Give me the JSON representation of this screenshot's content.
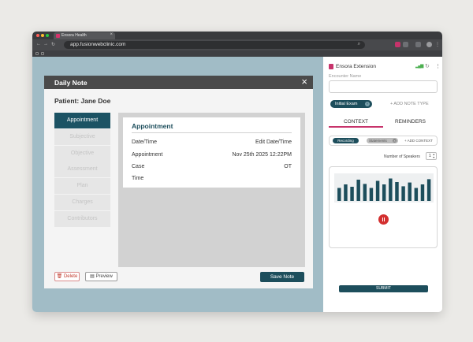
{
  "browser": {
    "tab_title": "Ensora Health",
    "tab_close": "×",
    "url": "app.fusionwebclinic.com"
  },
  "dialog": {
    "title": "Daily Note",
    "close": "×",
    "patient": "Patient: Jane Doe",
    "nav": [
      {
        "label": "Appointment",
        "active": true
      },
      {
        "label": "Subjective"
      },
      {
        "label": "Objective"
      },
      {
        "label": "Assessment"
      },
      {
        "label": "Plan"
      },
      {
        "label": "Charges"
      },
      {
        "label": "Contributors"
      }
    ],
    "card": {
      "title": "Appointment",
      "rows": [
        {
          "label": "Date/Time",
          "value": "Edit Date/Time"
        },
        {
          "label": "Appointment",
          "value": "Nov 25th 2025 12:22PM"
        },
        {
          "label": "Case",
          "value": "OT"
        },
        {
          "label": "Time",
          "value": ""
        }
      ]
    },
    "buttons": {
      "delete": "Delete",
      "preview": "Preview",
      "save": "Save Note"
    }
  },
  "extension": {
    "title": "Ensora Extension",
    "encounter_label": "Encounter Name",
    "encounter_value": "",
    "note_type_chip": "Initial Exam",
    "add_note_type": "+ ADD NOTE TYPE",
    "tabs": {
      "context": "CONTEXT",
      "reminders": "REMINDERS"
    },
    "context_pills": {
      "recording": "Recording",
      "statements": "Statements",
      "add_context": "+ ADD CONTEXT"
    },
    "speakers_label": "Number of Speakers",
    "speakers_value": "1",
    "waveform_levels": [
      0.55,
      0.7,
      0.6,
      0.9,
      0.72,
      0.55,
      0.85,
      0.7,
      0.95,
      0.8,
      0.62,
      0.78,
      0.55,
      0.7,
      0.92
    ],
    "submit": "SUBMIT"
  },
  "colors": {
    "accent": "#1d4e5c",
    "brand": "#c7336b",
    "record": "#d32f2f",
    "backdrop": "#a1bcc6"
  }
}
